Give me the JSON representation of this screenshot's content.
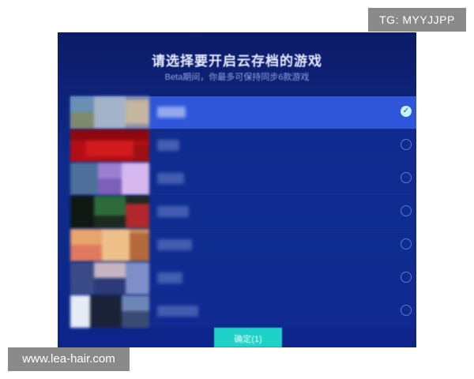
{
  "watermarks": {
    "top_tag": "TG: MYYJJPP",
    "bottom_url": "www.lea-hair.com"
  },
  "dialog": {
    "title": "请选择要开启云存档的游戏",
    "subtitle": "Beta期间，你最多可保持同步6款游戏",
    "games": [
      {
        "selected": true,
        "check_glyph": "✓"
      },
      {
        "selected": false,
        "check_glyph": ""
      },
      {
        "selected": false,
        "check_glyph": ""
      },
      {
        "selected": false,
        "check_glyph": ""
      },
      {
        "selected": false,
        "check_glyph": ""
      },
      {
        "selected": false,
        "check_glyph": ""
      },
      {
        "selected": false,
        "check_glyph": ""
      }
    ],
    "confirm_label": "确定(1)"
  },
  "colors": {
    "dialog_background": "#0f2a8c",
    "selected_row": "#2f56d9",
    "confirm_button": "#1fd2c7"
  }
}
